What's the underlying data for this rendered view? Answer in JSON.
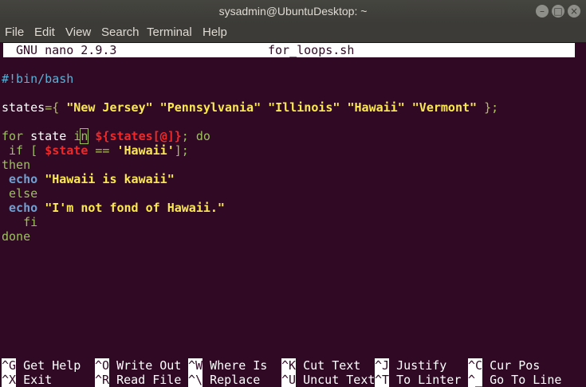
{
  "window": {
    "title": "sysadmin@UbuntuDesktop: ~",
    "buttons": [
      "–",
      "□",
      "×"
    ]
  },
  "menu": [
    "File",
    "Edit",
    "View",
    "Search",
    "Terminal",
    "Help"
  ],
  "nano": {
    "version": "GNU nano 2.9.3",
    "filename": "for_loops.sh"
  },
  "code": {
    "shebang": "#!bin/bash",
    "states_var": "states",
    "states_open": "={ ",
    "states_values": "\"New Jersey\" \"Pennsylvania\" \"Illinois\" \"Hawaii\" \"Vermont\"",
    "states_close": " };",
    "for_kw": "for",
    "loop_var": " state ",
    "in_kw_i": "i",
    "in_kw_n": "n",
    "array_expr": "${states[@]}",
    "do_part": "; do",
    "if_open": " if [ ",
    "state_ref": "$state",
    "eq_op": " == ",
    "hawaii_quoted": "'Hawaii'",
    "if_close": "];",
    "then_kw": "then",
    "echo_cmd": "echo",
    "echo1_str": "\"Hawaii is kawaii\"",
    "else_kw": " else",
    "echo2_str": "\"I'm not fond of Hawaii.\"",
    "fi_kw": "   fi",
    "done_kw": "done"
  },
  "shortcuts": [
    {
      "key": "^G",
      "label": "Get Help"
    },
    {
      "key": "^O",
      "label": "Write Out"
    },
    {
      "key": "^W",
      "label": "Where Is"
    },
    {
      "key": "^K",
      "label": "Cut Text"
    },
    {
      "key": "^J",
      "label": "Justify"
    },
    {
      "key": "^C",
      "label": "Cur Pos"
    },
    {
      "key": "^X",
      "label": "Exit"
    },
    {
      "key": "^R",
      "label": "Read File"
    },
    {
      "key": "^\\",
      "label": "Replace"
    },
    {
      "key": "^U",
      "label": "Uncut Text"
    },
    {
      "key": "^T",
      "label": "To Linter"
    },
    {
      "key": "^_",
      "label": "Go To Line"
    }
  ],
  "colors": {
    "terminal_bg": "#300a24",
    "titlebar_bg": "#3c3b37",
    "comment": "#5bb0d6",
    "keyword": "#9cc05b",
    "string": "#fce94f",
    "variable": "#ef2929",
    "command": "#729fcf"
  }
}
